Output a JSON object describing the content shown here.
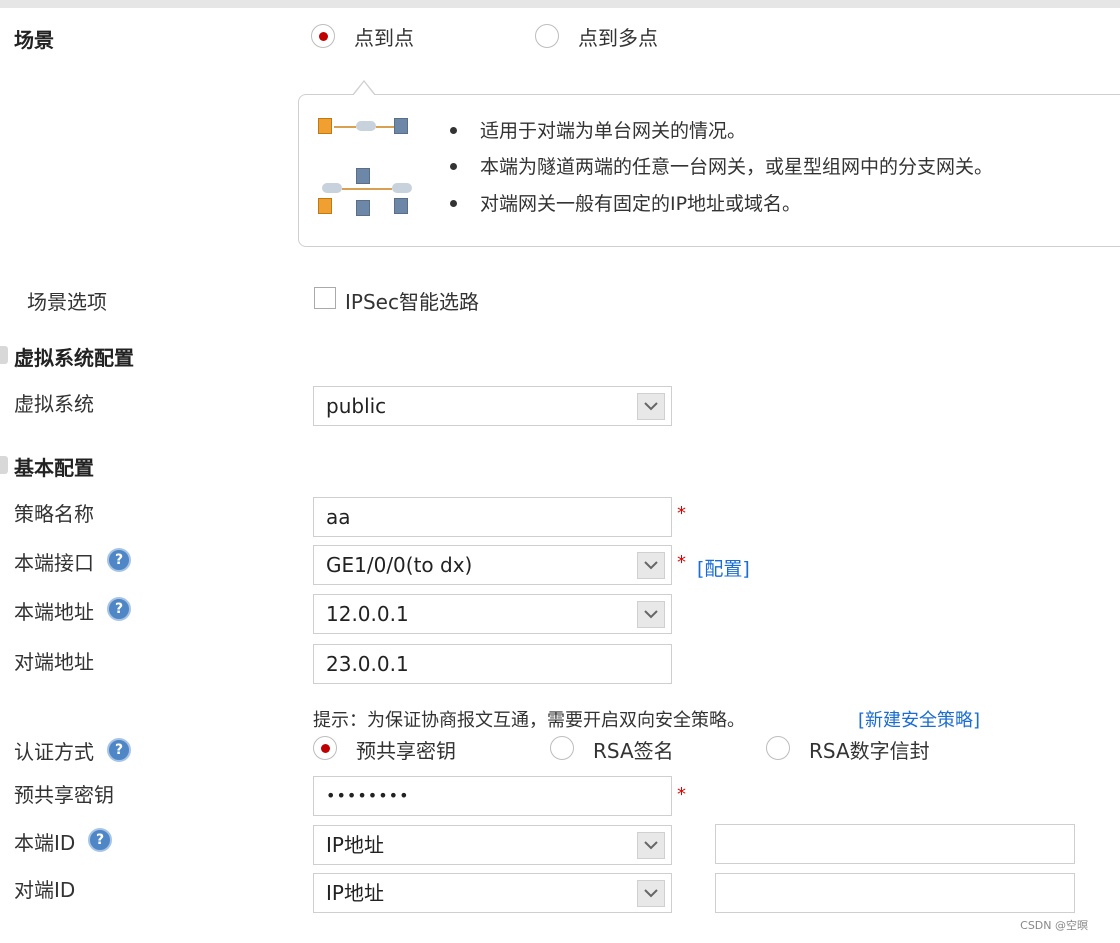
{
  "scene": {
    "label": "场景",
    "options": [
      {
        "label": "点到点",
        "selected": true
      },
      {
        "label": "点到多点",
        "selected": false
      }
    ],
    "info": {
      "bullets": [
        "适用于对端为单台网关的情况。",
        "本端为隧道两端的任意一台网关，或星型组网中的分支网关。",
        "对端网关一般有固定的IP地址或域名。"
      ]
    }
  },
  "scene_options": {
    "label": "场景选项",
    "checkbox_label": "IPSec智能选路",
    "checked": false
  },
  "virtual_system_section": {
    "title": "虚拟系统配置",
    "vsys_label": "虚拟系统",
    "vsys_value": "public"
  },
  "basic_section": {
    "title": "基本配置",
    "policy_name_label": "策略名称",
    "policy_name_value": "aa",
    "local_iface_label": "本端接口",
    "local_iface_value": "GE1/0/0(to dx)",
    "config_link": "[配置]",
    "local_addr_label": "本端地址",
    "local_addr_value": "12.0.0.1",
    "peer_addr_label": "对端地址",
    "peer_addr_value": "23.0.0.1",
    "hint_text": "提示：为保证协商报文互通，需要开启双向安全策略。",
    "new_policy_link": "[新建安全策略]",
    "auth_label": "认证方式",
    "auth_options": [
      {
        "label": "预共享密钥",
        "selected": true
      },
      {
        "label": "RSA签名",
        "selected": false
      },
      {
        "label": "RSA数字信封",
        "selected": false
      }
    ],
    "psk_label": "预共享密钥",
    "psk_value": "••••••••",
    "local_id_label": "本端ID",
    "local_id_type": "IP地址",
    "local_id_value": "",
    "peer_id_label": "对端ID",
    "peer_id_type": "IP地址",
    "peer_id_value": ""
  },
  "required_mark": "*",
  "help_glyph": "?",
  "watermark": "CSDN @空暝",
  "colors": {
    "required": "#e00000",
    "link": "#1a6cd6",
    "radio_selected": "#c00000",
    "help_icon": "#4f86c6"
  }
}
